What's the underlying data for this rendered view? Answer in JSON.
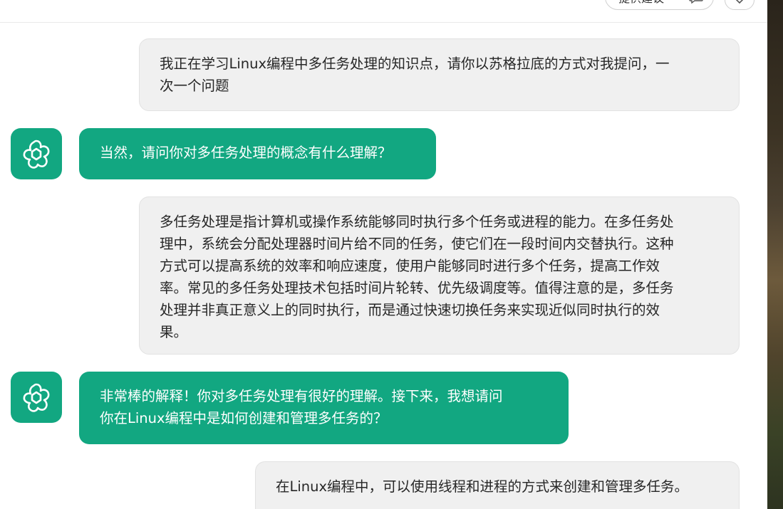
{
  "header": {
    "feedback_label": "提供建议",
    "feedback_icon": "chat-bubble-icon",
    "menu_icon": "chevron-down-icon"
  },
  "colors": {
    "accent": "#12a781",
    "user_bubble": "#f0f0f0"
  },
  "messages": [
    {
      "role": "user",
      "text": "我正在学习Linux编程中多任务处理的知识点，请你以苏格拉底的方式对我提问，一\n次一个问题"
    },
    {
      "role": "assistant",
      "avatar_icon": "flower-logo-icon",
      "text": "当然，请问你对多任务处理的概念有什么理解？"
    },
    {
      "role": "user",
      "text": "多任务处理是指计算机或操作系统能够同时执行多个任务或进程的能力。在多任务处\n理中，系统会分配处理器时间片给不同的任务，使它们在一段时间内交替执行。这种\n方式可以提高系统的效率和响应速度，使用户能够同时进行多个任务，提高工作效\n率。常见的多任务处理技术包括时间片轮转、优先级调度等。值得注意的是，多任务\n处理并非真正意义上的同时执行，而是通过快速切换任务来实现近似同时执行的效\n果。"
    },
    {
      "role": "assistant",
      "avatar_icon": "flower-logo-icon",
      "text": "非常棒的解释！你对多任务处理有很好的理解。接下来，我想请问\n你在Linux编程中是如何创建和管理多任务的？"
    },
    {
      "role": "user",
      "text": "在Linux编程中，可以使用线程和进程的方式来创建和管理多任务。"
    }
  ]
}
